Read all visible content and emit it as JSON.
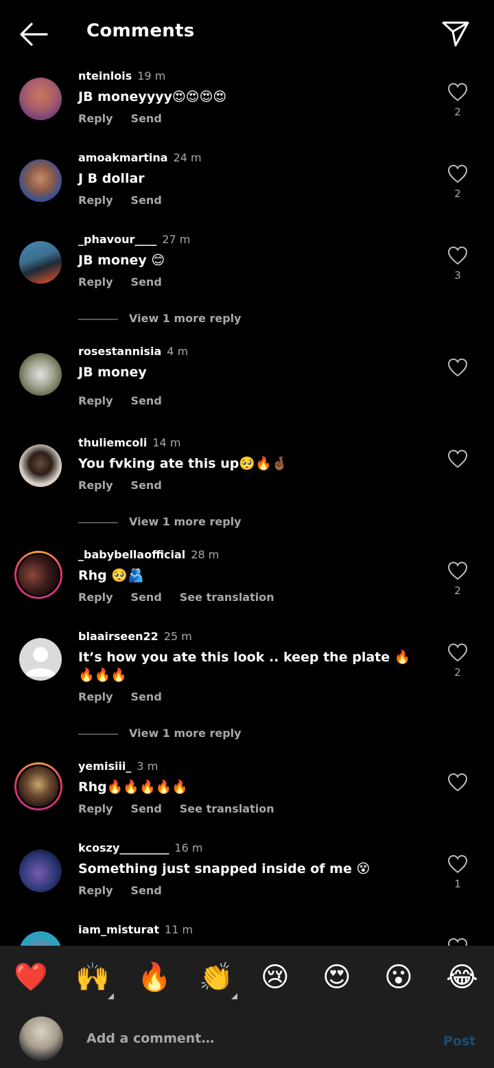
{
  "header": {
    "title": "Comments",
    "back_icon": "arrow-left-icon",
    "send_icon": "paper-plane-icon"
  },
  "comments": [
    {
      "username": "nteinlois",
      "time": "19 m",
      "text": "JB moneyyyy😍😍😍😍",
      "actions": [
        "Reply",
        "Send"
      ],
      "likes": "2",
      "avatar_colors": [
        "#c97a5c",
        "#6a3d7a"
      ]
    },
    {
      "username": "amoakmartina",
      "time": "24 m",
      "text": "J B dollar",
      "actions": [
        "Reply",
        "Send"
      ],
      "likes": "2",
      "avatar_colors": [
        "#2b4fa0",
        "#c88c6b"
      ]
    },
    {
      "username": "_phavour____",
      "time": "27 m",
      "text": "JB money 😊",
      "actions": [
        "Reply",
        "Send"
      ],
      "likes": "3",
      "avatar_colors": [
        "#3c6e8f",
        "#c04a2e"
      ]
    },
    {
      "username": "rosestannisia",
      "time": "4 m",
      "text": "JB money",
      "actions": [
        "Reply",
        "Send"
      ],
      "likes": "",
      "avatar_colors": [
        "#8c8f6a",
        "#e2e2df"
      ]
    },
    {
      "username": "thuliemcoli",
      "time": "14 m",
      "text": "You fvking ate this up🥺🔥🤞🏾",
      "actions": [
        "Reply",
        "Send"
      ],
      "likes": "",
      "avatar_colors": [
        "#d8d0c6",
        "#2b1e18"
      ]
    },
    {
      "username": "_babybellaofficial",
      "time": "28 m",
      "text": "Rhg 🥺🫂",
      "actions": [
        "Reply",
        "Send",
        "See translation"
      ],
      "likes": "2",
      "avatar_colors": [
        "#3a1a1a",
        "#8a4a3a"
      ]
    },
    {
      "username": "blaairseen22",
      "time": "25 m",
      "text": "It’s how you ate this look .. keep the plate 🔥🔥🔥🔥",
      "actions": [
        "Reply",
        "Send"
      ],
      "likes": "2",
      "avatar_colors": [
        "#dbdbdb",
        "#ffffff"
      ]
    },
    {
      "username": "yemisiii_",
      "time": "3 m",
      "text": "Rhg🔥🔥🔥🔥🔥",
      "actions": [
        "Reply",
        "Send",
        "See translation"
      ],
      "likes": "",
      "avatar_colors": [
        "#caa76a",
        "#2a1a12"
      ]
    },
    {
      "username": "kcoszy_________",
      "time": "16 m",
      "text": "Something just snapped inside of me 😵",
      "actions": [
        "Reply",
        "Send"
      ],
      "likes": "1",
      "avatar_colors": [
        "#2e3a7a",
        "#7a5ab0"
      ]
    },
    {
      "username": "iam_misturat",
      "time": "11 m",
      "text": "",
      "actions": [],
      "likes": "",
      "avatar_colors": [
        "#2aa3c0",
        "#c05a8a"
      ]
    }
  ],
  "view_more": [
    "View 1 more reply",
    "View 1 more reply",
    "View 1 more reply"
  ],
  "emoji_bar": [
    "❤️",
    "🙌",
    "🔥",
    "👏",
    "😢",
    "😍",
    "😮",
    "😂"
  ],
  "comment_bar": {
    "placeholder": "Add a comment…",
    "post_label": "Post"
  }
}
